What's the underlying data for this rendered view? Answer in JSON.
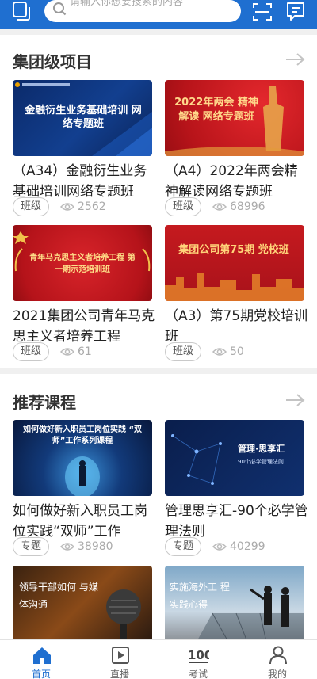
{
  "search": {
    "placeholder": "请输入你想要搜索的内容"
  },
  "group_section": {
    "title": "集团级项目",
    "cards": [
      {
        "thumb_title": "金融衍生业务基础培训 网络专题班",
        "title": "（A34）金融衍生业务基础培训网络专题班",
        "tag": "班级",
        "views": "2562"
      },
      {
        "thumb_title": "2022年两会 精神解读 网络专题班",
        "title": "（A4）2022年两会精神解读网络专题班",
        "tag": "班级",
        "views": "68996"
      },
      {
        "thumb_title": "青年马克思主义者培养工程 第一期示范培训班",
        "title": "2021集团公司青年马克思主义者培养工程",
        "tag": "班级",
        "views": "61"
      },
      {
        "thumb_title": "集团公司第75期 党校班",
        "title": "（A3）第75期党校培训班",
        "tag": "班级",
        "views": "50"
      }
    ]
  },
  "recommend_section": {
    "title": "推荐课程",
    "cards": [
      {
        "thumb_title": "如何做好新入职员工岗位实践 “双师”工作系列课程",
        "title": "如何做好新入职员工岗位实践“双师”工作",
        "tag": "专题",
        "views": "38980"
      },
      {
        "thumb_title": "管理·思享汇",
        "thumb_subtitle": "90个必学管理法则",
        "title": "管理思享汇-90个必学管理法则",
        "tag": "专题",
        "views": "40299"
      },
      {
        "thumb_title": "领导干部如何 与媒体沟通"
      },
      {
        "thumb_title": "实施海外工 程实践心得"
      }
    ]
  },
  "bottom_nav": [
    {
      "label": "首页",
      "icon": "home-icon",
      "active": true
    },
    {
      "label": "直播",
      "icon": "live-icon",
      "active": false
    },
    {
      "label": "考试",
      "icon": "exam-icon",
      "active": false
    },
    {
      "label": "我的",
      "icon": "profile-icon",
      "active": false
    }
  ],
  "colors": {
    "brand_blue": "#1f6fd0",
    "red_banner": "#c8161d",
    "navy_banner": "#0d2a66"
  }
}
